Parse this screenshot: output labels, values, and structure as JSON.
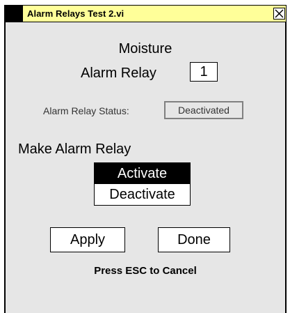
{
  "window": {
    "title": "Alarm Relays Test 2.vi",
    "titlebar_color": "#ffff99",
    "background_color": "#e6e6e6",
    "close_icon": "close-icon"
  },
  "panel": {
    "moisture_label": "Moisture",
    "relay_label": "Alarm Relay",
    "relay_number": "1",
    "status_label": "Alarm Relay Status:",
    "status_value": "Deactivated",
    "make_label": "Make Alarm Relay",
    "options": [
      {
        "label": "Activate",
        "selected": true
      },
      {
        "label": "Deactivate",
        "selected": false
      }
    ],
    "apply_label": "Apply",
    "done_label": "Done",
    "esc_hint": "Press ESC to Cancel"
  }
}
